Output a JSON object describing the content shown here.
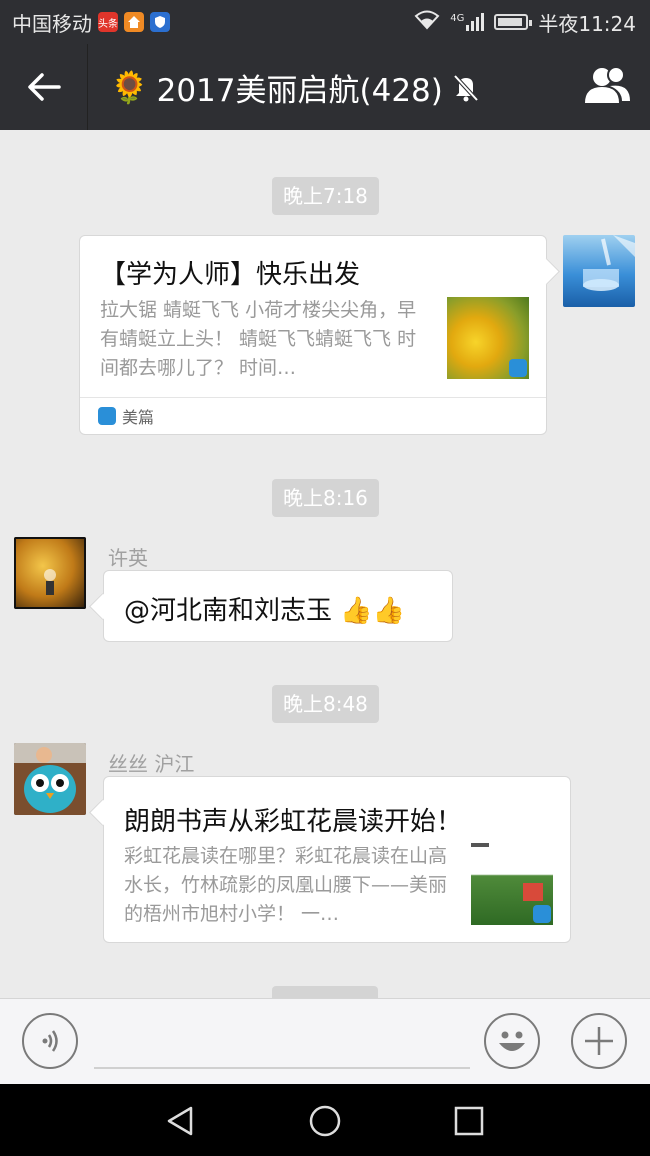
{
  "status_bar": {
    "carrier": "中国移动",
    "mini_icon_1": "头条",
    "network": "4G",
    "time": "半夜11:24"
  },
  "header": {
    "emoji": "🌻",
    "title": "2017美丽启航(428)"
  },
  "messages": [
    {
      "time": "晚上7:18",
      "side": "right",
      "card": {
        "title": "【学为人师】快乐出发",
        "description": "拉大锯 蜻蜓飞飞 小荷才楼尖尖角，早有蜻蜓立上头！ 蜻蜓飞飞蜻蜓飞飞 时间都去哪儿了？ 时间…",
        "source": "美篇"
      }
    },
    {
      "time": "晚上8:16",
      "side": "left",
      "sender": "许英",
      "text": "@河北南和刘志玉 👍👍"
    },
    {
      "time": "晚上8:48",
      "side": "left",
      "sender": "丝丝 沪江",
      "card": {
        "title": "朗朗书声从彩虹花晨读开始！",
        "description": "彩虹花晨读在哪里？彩虹花晨读在山高水长，竹林疏影的凤凰山腰下——美丽的梧州市旭村小学！ 一…"
      }
    }
  ],
  "icons": [
    "back-arrow-icon",
    "mute-bell-icon",
    "group-members-icon",
    "voice-icon",
    "emoji-icon",
    "plus-icon",
    "nav-back-icon",
    "nav-home-icon",
    "nav-recents-icon"
  ],
  "colors": {
    "header_bg": "#2e2f33",
    "chat_bg": "#ebebeb",
    "timestamp_bg": "#d4d4d4",
    "meipian_blue": "#2a8fd8"
  }
}
